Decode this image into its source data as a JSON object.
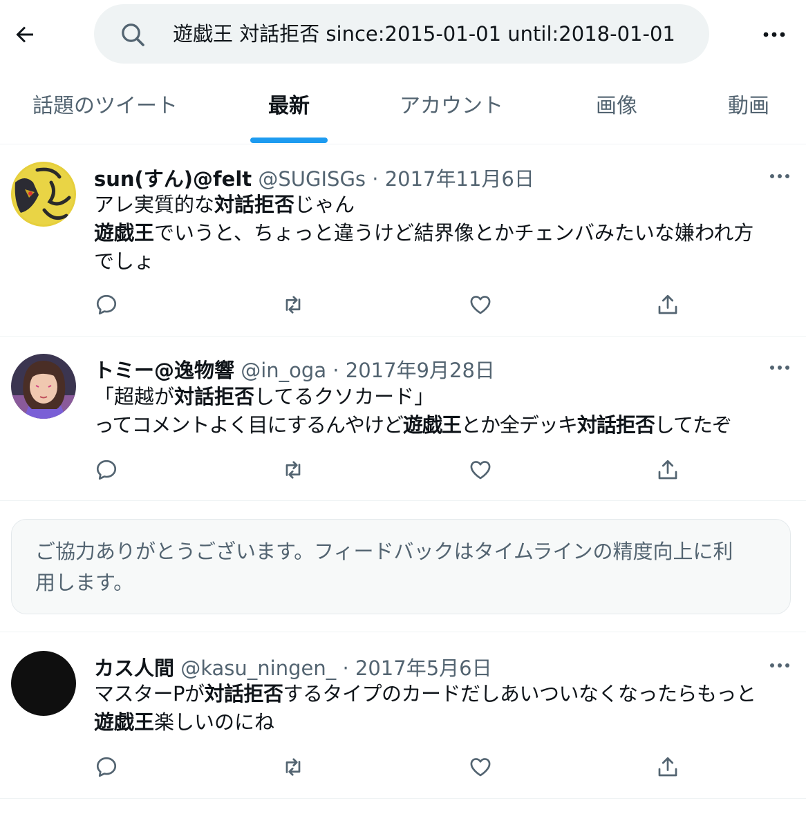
{
  "header": {
    "search_query": "遊戯王 対話拒否 since:2015-01-01 until:2018-01-01"
  },
  "tabs": [
    {
      "label": "話題のツイート",
      "active": false
    },
    {
      "label": "最新",
      "active": true
    },
    {
      "label": "アカウント",
      "active": false
    },
    {
      "label": "画像",
      "active": false
    },
    {
      "label": "動画",
      "active": false
    }
  ],
  "tweets": [
    {
      "name": "sun(すん)@felt",
      "handle": "@SUGISGs",
      "sep": " · ",
      "date": "2017年11月6日",
      "lines": [
        [
          {
            "t": "アレ実質的な",
            "b": false
          },
          {
            "t": "対話拒否",
            "b": true
          },
          {
            "t": "じゃん",
            "b": false
          }
        ],
        [
          {
            "t": "遊戯王",
            "b": true
          },
          {
            "t": "でいうと、ちょっと違うけど結界像とかチェンバみたいな嫌われ方",
            "b": false
          }
        ],
        [
          {
            "t": "でしょ",
            "b": false
          }
        ]
      ]
    },
    {
      "name": "トミー@逸物響",
      "handle": "@in_oga",
      "sep": " · ",
      "date": "2017年9月28日",
      "lines": [
        [
          {
            "t": "「超越が",
            "b": false
          },
          {
            "t": "対話拒否",
            "b": true
          },
          {
            "t": "してるクソカード」",
            "b": false
          }
        ],
        [
          {
            "t": "ってコメントよく目にするんやけど",
            "b": false
          },
          {
            "t": "遊戯王",
            "b": true
          },
          {
            "t": "とか全デッキ",
            "b": false
          },
          {
            "t": "対話拒否",
            "b": true
          },
          {
            "t": "してたぞ",
            "b": false
          }
        ]
      ]
    },
    {
      "name": "カス人間",
      "handle": "@kasu_ningen_",
      "sep": " · ",
      "date": "2017年5月6日",
      "lines": [
        [
          {
            "t": "マスターPが",
            "b": false
          },
          {
            "t": "対話拒否",
            "b": true
          },
          {
            "t": "するタイプのカードだしあいついなくなったらもっと",
            "b": false
          }
        ],
        [
          {
            "t": "遊戯王",
            "b": true
          },
          {
            "t": "楽しいのにね",
            "b": false
          }
        ]
      ]
    }
  ],
  "feedback": {
    "line1": "ご協力ありがとうございます。フィードバックはタイムラインの精度向上に利",
    "line2": "用します。"
  },
  "colors": {
    "accent": "#1d9bf0",
    "text": "#0f1419",
    "secondary": "#536471",
    "search_bg": "#eff3f4",
    "divider": "#eff3f4"
  },
  "icons": {
    "back": "arrow-left-icon",
    "search": "search-icon",
    "more": "more-horizontal-icon",
    "reply": "reply-icon",
    "retweet": "retweet-icon",
    "like": "heart-icon",
    "share": "share-icon"
  }
}
